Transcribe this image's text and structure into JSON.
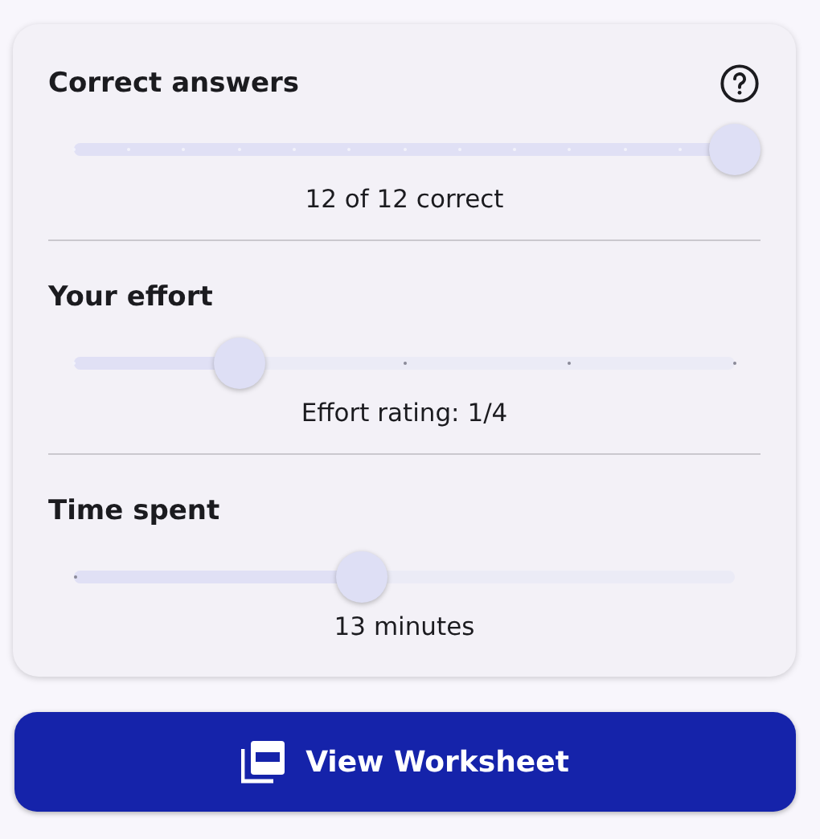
{
  "sections": [
    {
      "title": "Correct answers",
      "help": true,
      "slider": {
        "kind": "fine",
        "level": 1.0
      },
      "caption": "12 of 12 correct"
    },
    {
      "title": "Your effort",
      "help": false,
      "slider": {
        "kind": "coarse",
        "level": 0.25
      },
      "caption": "Effort rating: 1/4"
    },
    {
      "title": "Time spent",
      "help": false,
      "slider": {
        "kind": "smooth",
        "level": 0.435
      },
      "caption": "13 minutes"
    }
  ],
  "button": {
    "label": "View Worksheet"
  }
}
